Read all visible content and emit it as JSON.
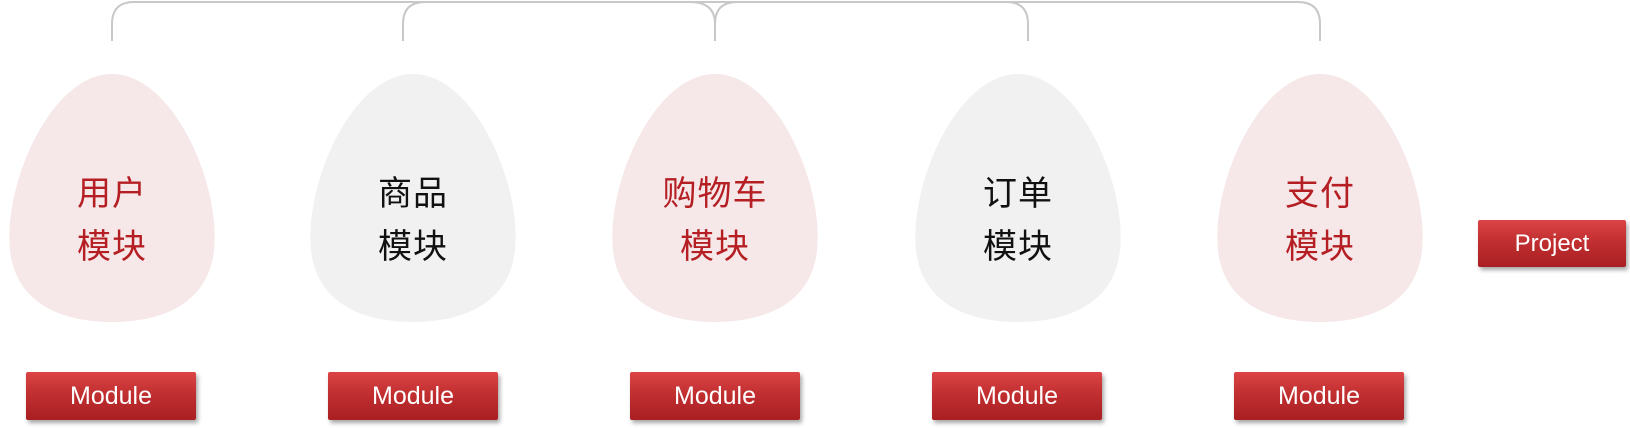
{
  "colors": {
    "accent_red": "#b51f24",
    "button_red": "#c12f31",
    "pink_fill": "#f6e7e8",
    "gray_fill": "#f1f1f1",
    "connector_gray": "#c8c8c8"
  },
  "modules": [
    {
      "line1": "用户",
      "line2": "模块",
      "button": "Module"
    },
    {
      "line1": "商品",
      "line2": "模块",
      "button": "Module"
    },
    {
      "line1": "购物车",
      "line2": "模块",
      "button": "Module"
    },
    {
      "line1": "订单",
      "line2": "模块",
      "button": "Module"
    },
    {
      "line1": "支付",
      "line2": "模块",
      "button": "Module"
    }
  ],
  "project": {
    "label": "Project"
  }
}
